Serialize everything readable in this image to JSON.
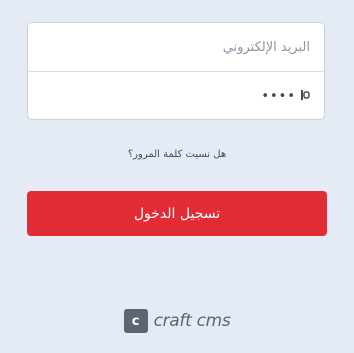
{
  "login": {
    "email_placeholder": "البريد الإلكتروني",
    "password_dots": "••••",
    "password_reveal_icon": "eye-icon",
    "forgot_link": "هل نسيت كلمة المرور؟",
    "submit_label": "تسجيل الدخول"
  },
  "brand": {
    "mark": "c",
    "name": "craft cms"
  },
  "colors": {
    "background": "#e4ebf5",
    "accent": "#e12c35",
    "brand_gray": "#5b6670"
  }
}
